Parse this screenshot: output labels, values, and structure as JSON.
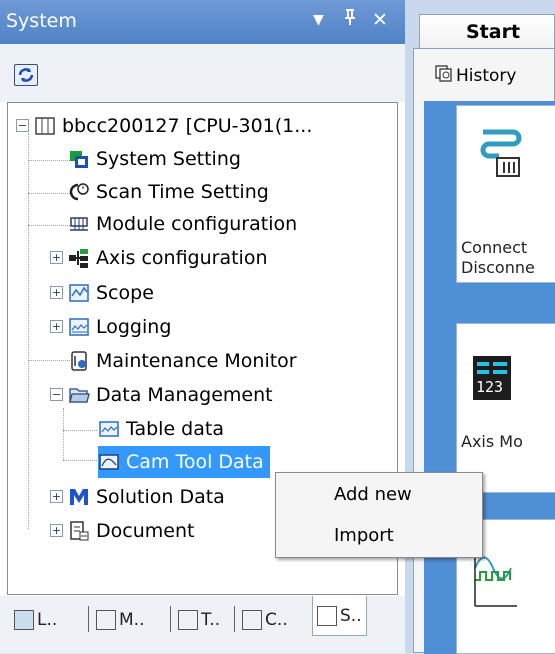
{
  "panel": {
    "title": "System",
    "dropdown_glyph": "▼",
    "pin_glyph": "ᵖ",
    "close_glyph": "✕",
    "refresh_icon": "refresh-icon"
  },
  "tree": {
    "root": "bbcc200127 [CPU-301(1...",
    "items": [
      {
        "label": "System Setting",
        "icon": "system-setting-icon"
      },
      {
        "label": "Scan Time Setting",
        "icon": "scan-time-icon"
      },
      {
        "label": "Module configuration",
        "icon": "module-config-icon"
      },
      {
        "label": "Axis configuration",
        "icon": "axis-config-icon"
      },
      {
        "label": "Scope",
        "icon": "scope-icon"
      },
      {
        "label": "Logging",
        "icon": "logging-icon"
      },
      {
        "label": "Maintenance Monitor",
        "icon": "maintenance-monitor-icon"
      },
      {
        "label": "Data Management",
        "icon": "folder-open-icon"
      },
      {
        "label": "Table data",
        "icon": "table-data-icon"
      },
      {
        "label": "Cam Tool Data",
        "icon": "cam-tool-data-icon"
      },
      {
        "label": "Solution Data",
        "icon": "solution-data-icon"
      },
      {
        "label": "Document",
        "icon": "document-icon"
      }
    ]
  },
  "bottom_tabs": [
    {
      "label": "L..",
      "icon": "layout-tab-icon"
    },
    {
      "label": "M..",
      "icon": "monitor-tab-icon"
    },
    {
      "label": "T..",
      "icon": "tree-tab-icon"
    },
    {
      "label": "C..",
      "icon": "c-tab-icon"
    },
    {
      "label": "S..",
      "icon": "system-tab-icon"
    }
  ],
  "start": {
    "tab_label": "Start",
    "history_label": "History",
    "tile1_line1": "Connect",
    "tile1_line2": "Disconne",
    "tile2_digits": "123",
    "tile2_label": "Axis Mo"
  },
  "context_menu": {
    "items": [
      "Add new",
      "Import"
    ]
  },
  "colors": {
    "header_blue": "#4f82c6",
    "selection": "#3399ff",
    "start_panel_blue": "#4f8fd6"
  }
}
